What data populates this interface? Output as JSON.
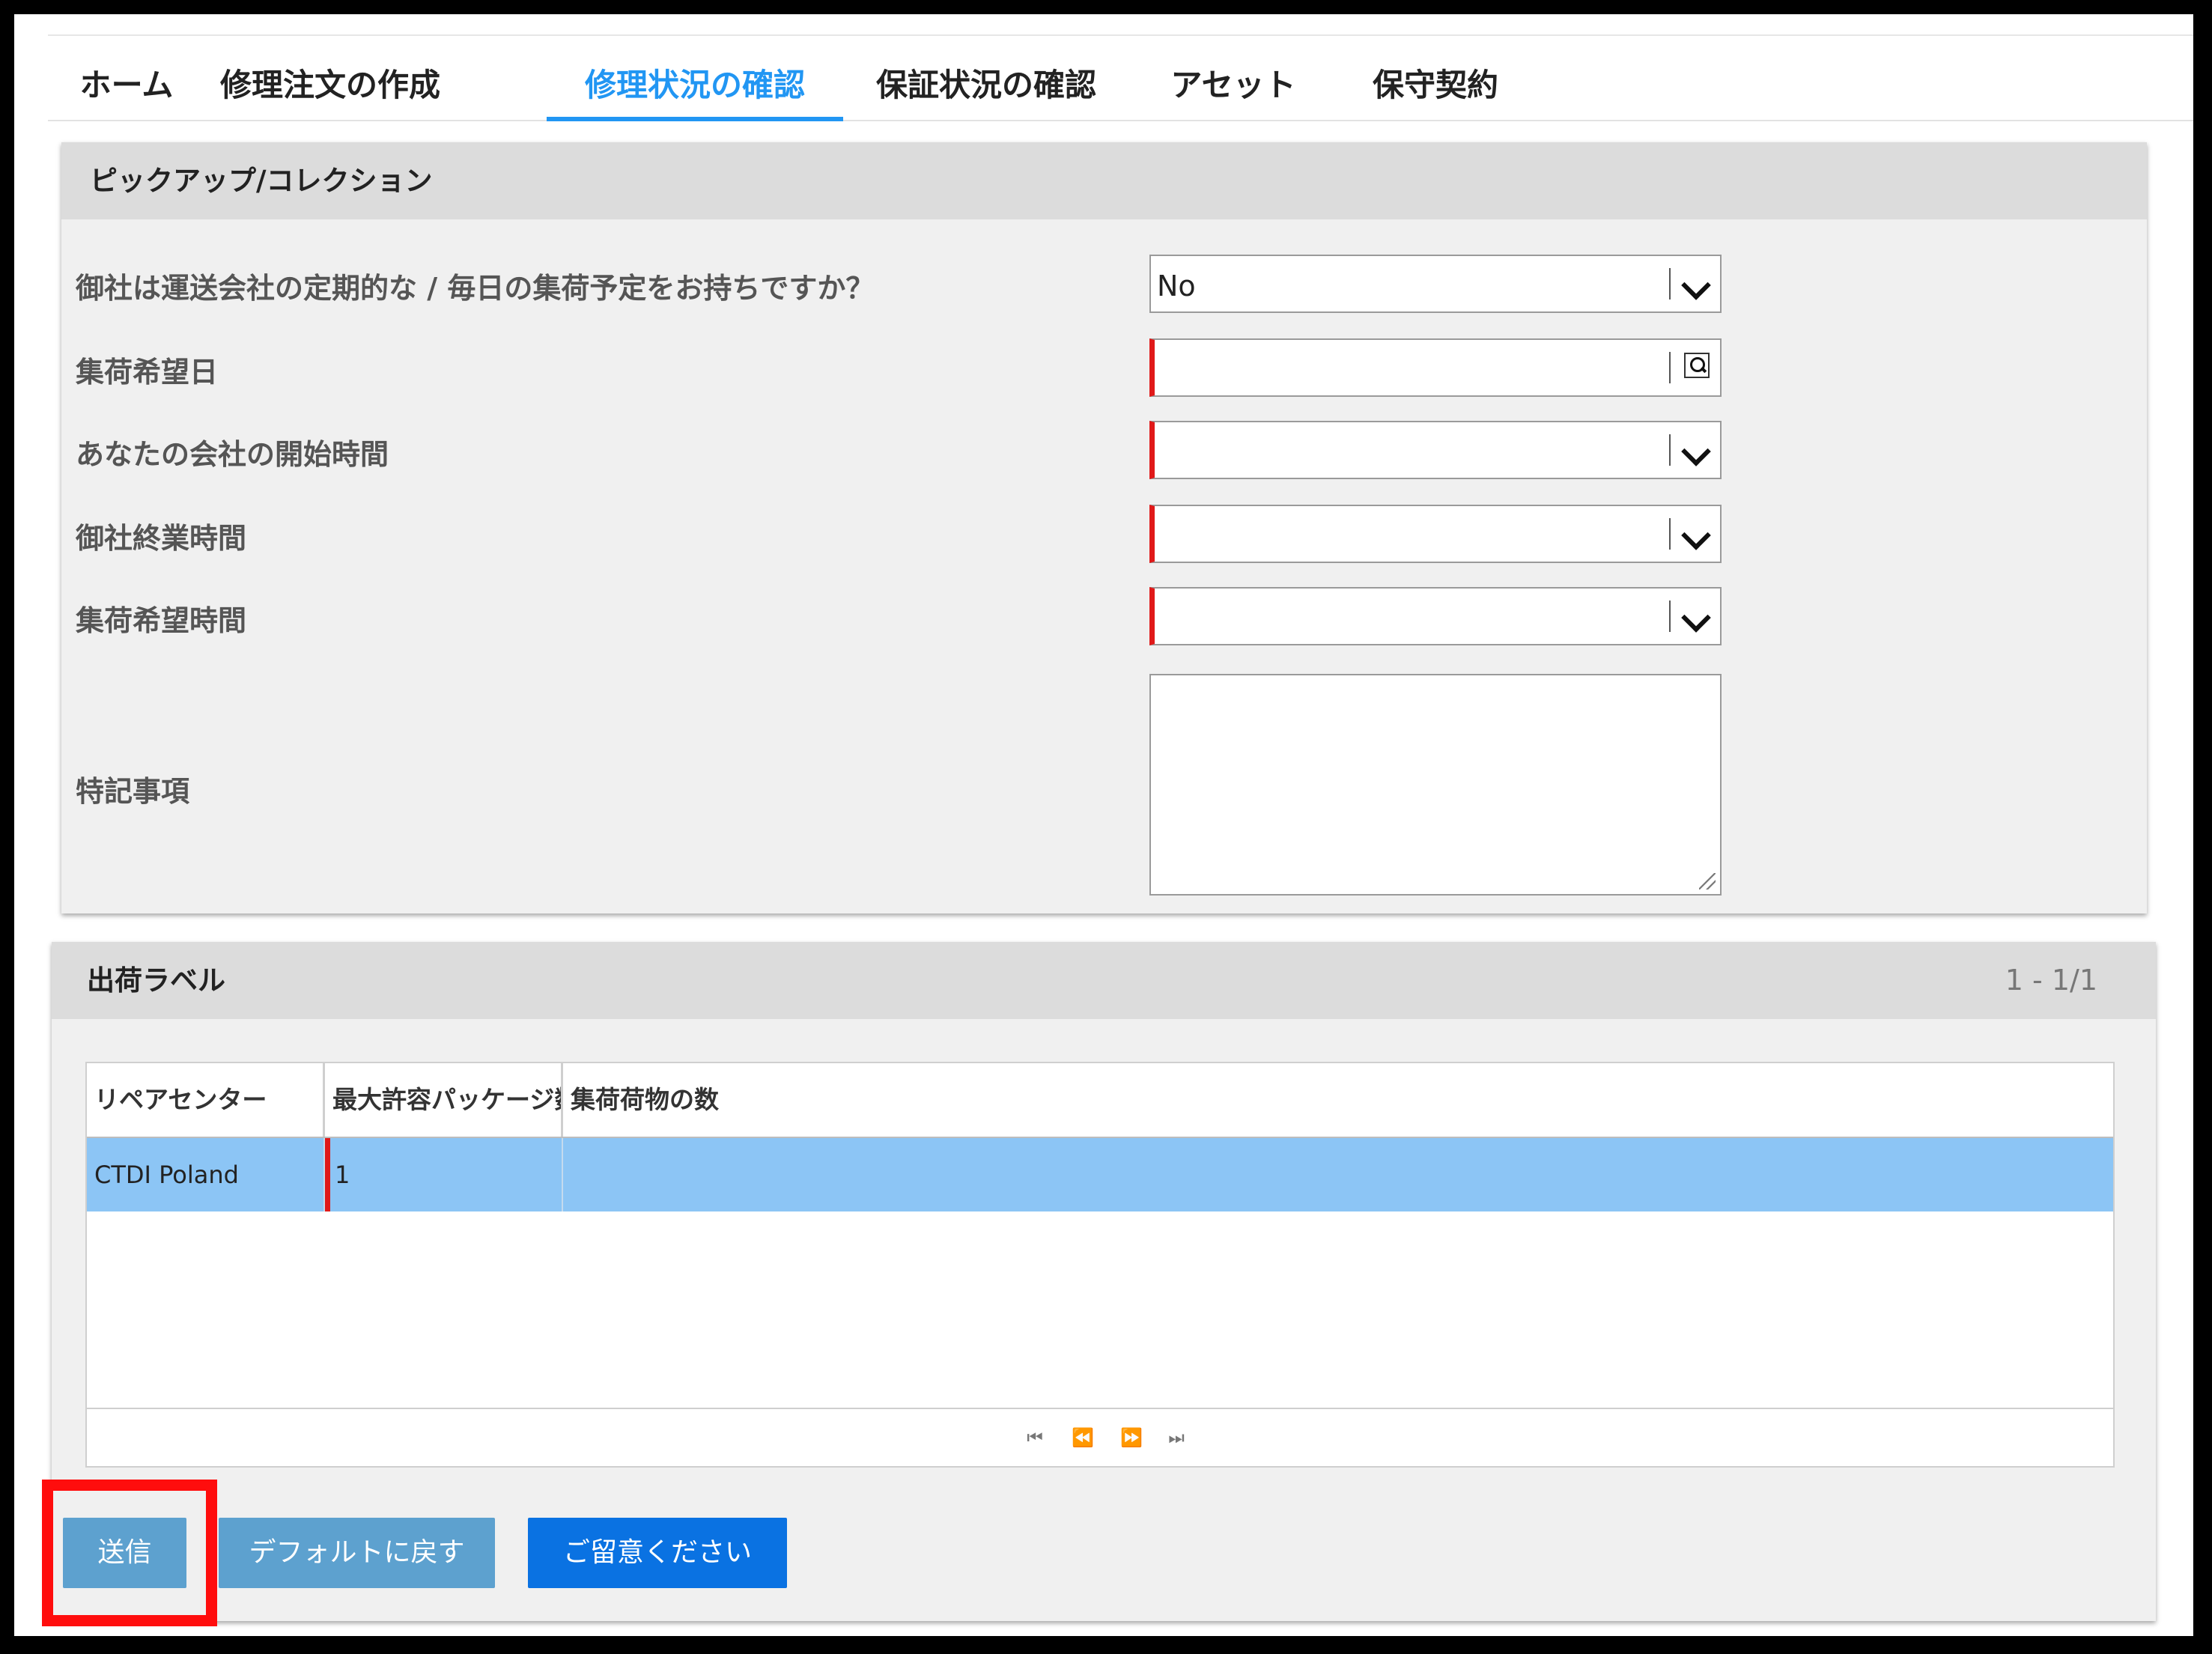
{
  "nav": {
    "tabs": [
      {
        "label": "ホーム"
      },
      {
        "label": "修理注文の作成"
      },
      {
        "label": "修理状況の確認",
        "active": true
      },
      {
        "label": "保証状況の確認"
      },
      {
        "label": "アセット"
      },
      {
        "label": "保守契約"
      }
    ]
  },
  "pickup": {
    "title": "ピックアップ/コレクション",
    "fields": {
      "schedule": {
        "label": "御社は運送会社の定期的な / 毎日の集荷予定をお持ちですか？",
        "value": "No"
      },
      "date": {
        "label": "集荷希望日",
        "value": ""
      },
      "start_time": {
        "label": "あなたの会社の開始時間",
        "value": ""
      },
      "end_time": {
        "label": "御社終業時間",
        "value": ""
      },
      "pickup_time": {
        "label": "集荷希望時間",
        "value": ""
      },
      "notes": {
        "label": "特記事項",
        "value": ""
      }
    }
  },
  "shipping": {
    "title": "出荷ラベル",
    "count": "1 - 1/1",
    "columns": [
      "リペアセンター",
      "最大許容パッケージ数",
      "集荷荷物の数"
    ],
    "rows": [
      [
        "CTDI Poland",
        "1",
        ""
      ]
    ],
    "pager": {
      "first": "⏮",
      "prev": "⏪",
      "next": "⏩",
      "last": "⏭"
    }
  },
  "buttons": {
    "submit": "送信",
    "reset": "デフォルトに戻す",
    "notice": "ご留意ください"
  },
  "colors": {
    "accent": "#2196f3",
    "required": "#e01919",
    "selected_row": "#8cc5f5",
    "primary_button": "#0a72e2",
    "highlight": "#ff0d0d"
  }
}
